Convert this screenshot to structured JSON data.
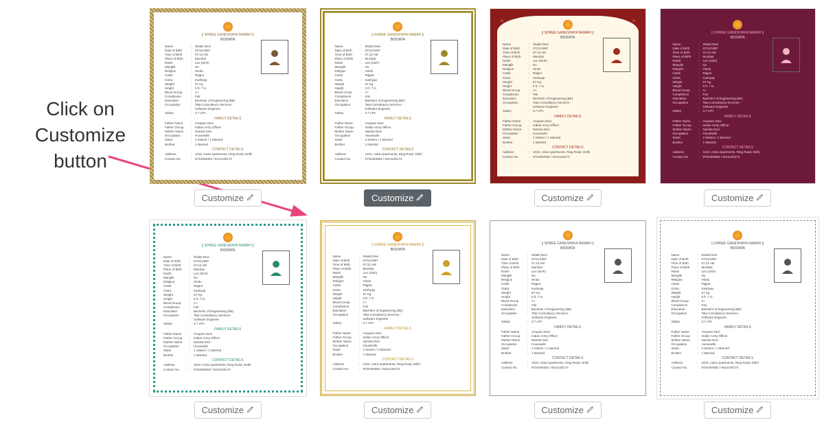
{
  "annotation": {
    "line1": "Click on",
    "line2": "Customize",
    "line3": "button"
  },
  "button_label": "Customize",
  "doc": {
    "header": "|| SHREE GANESHAYA NAMAH ||",
    "title": "BIODATA",
    "section_family": "FAMILY DETAILS",
    "section_contact": "CONTACT DETAILS",
    "personal": [
      {
        "k": "Name",
        "v": "Shakti Devi"
      },
      {
        "k": "Date of Birth",
        "v": "07/11/1997"
      },
      {
        "k": "Time of Birth",
        "v": "07:12 AM"
      },
      {
        "k": "Place of Birth",
        "v": "Mumbai"
      },
      {
        "k": "Rashi",
        "v": "Leo (Sinh)"
      },
      {
        "k": "Manglik",
        "v": "No"
      },
      {
        "k": "Religion",
        "v": "Hindu"
      },
      {
        "k": "Caste",
        "v": "Rajput"
      },
      {
        "k": "Gotra",
        "v": "Kashyap"
      },
      {
        "k": "Weight",
        "v": "67 Kg."
      },
      {
        "k": "Height",
        "v": "5 ft. 7 in."
      },
      {
        "k": "Blood Group",
        "v": "A+"
      },
      {
        "k": "Complexion",
        "v": "Fair"
      },
      {
        "k": "Education",
        "v": "Bachelor of Engineering (BE)"
      },
      {
        "k": "Occupation",
        "v": "Tata Consultancy Services - Software Engineer"
      },
      {
        "k": "Salary",
        "v": "3.7 LPA"
      }
    ],
    "family": [
      {
        "k": "Father Name",
        "v": "Anupam Devi"
      },
      {
        "k": "Father Occup.",
        "v": "Indian Army Officer"
      },
      {
        "k": "Mother Name",
        "v": "Namita Devi"
      },
      {
        "k": "Occupation",
        "v": "Housewife"
      },
      {
        "k": "Sister",
        "v": "2 Sisters / 1 Married"
      },
      {
        "k": "Brother",
        "v": "1 Married"
      }
    ],
    "contact": [
      {
        "k": "Address",
        "v": "1010, Astra Apartments, Ring Road, Delhi"
      },
      {
        "k": "Contact No.",
        "v": "9734484062 / 9414125174"
      }
    ]
  },
  "templates": [
    {
      "id": "t1",
      "border": "border-ornate",
      "accent": "accent-brown",
      "avatar": "#7a5a3a"
    },
    {
      "id": "t2",
      "border": "border-olive",
      "accent": "accent-olive",
      "avatar": "#9a8a2a",
      "active": true
    },
    {
      "id": "t3",
      "border": "border-red",
      "accent": "accent-redh",
      "avatar": "#a03020"
    },
    {
      "id": "t4",
      "border": "border-maroon",
      "accent": "accent-pink",
      "avatar": "#f5b5c5"
    },
    {
      "id": "t5",
      "border": "border-teal",
      "accent": "accent-teal",
      "avatar": "#2a8a6a"
    },
    {
      "id": "t6",
      "border": "border-gold",
      "accent": "accent-gold",
      "avatar": "#c9a227"
    },
    {
      "id": "t7",
      "border": "border-plain",
      "accent": "accent-grey",
      "avatar": "#555"
    },
    {
      "id": "t8",
      "border": "border-stitch",
      "accent": "accent-grey",
      "avatar": "#555"
    }
  ]
}
